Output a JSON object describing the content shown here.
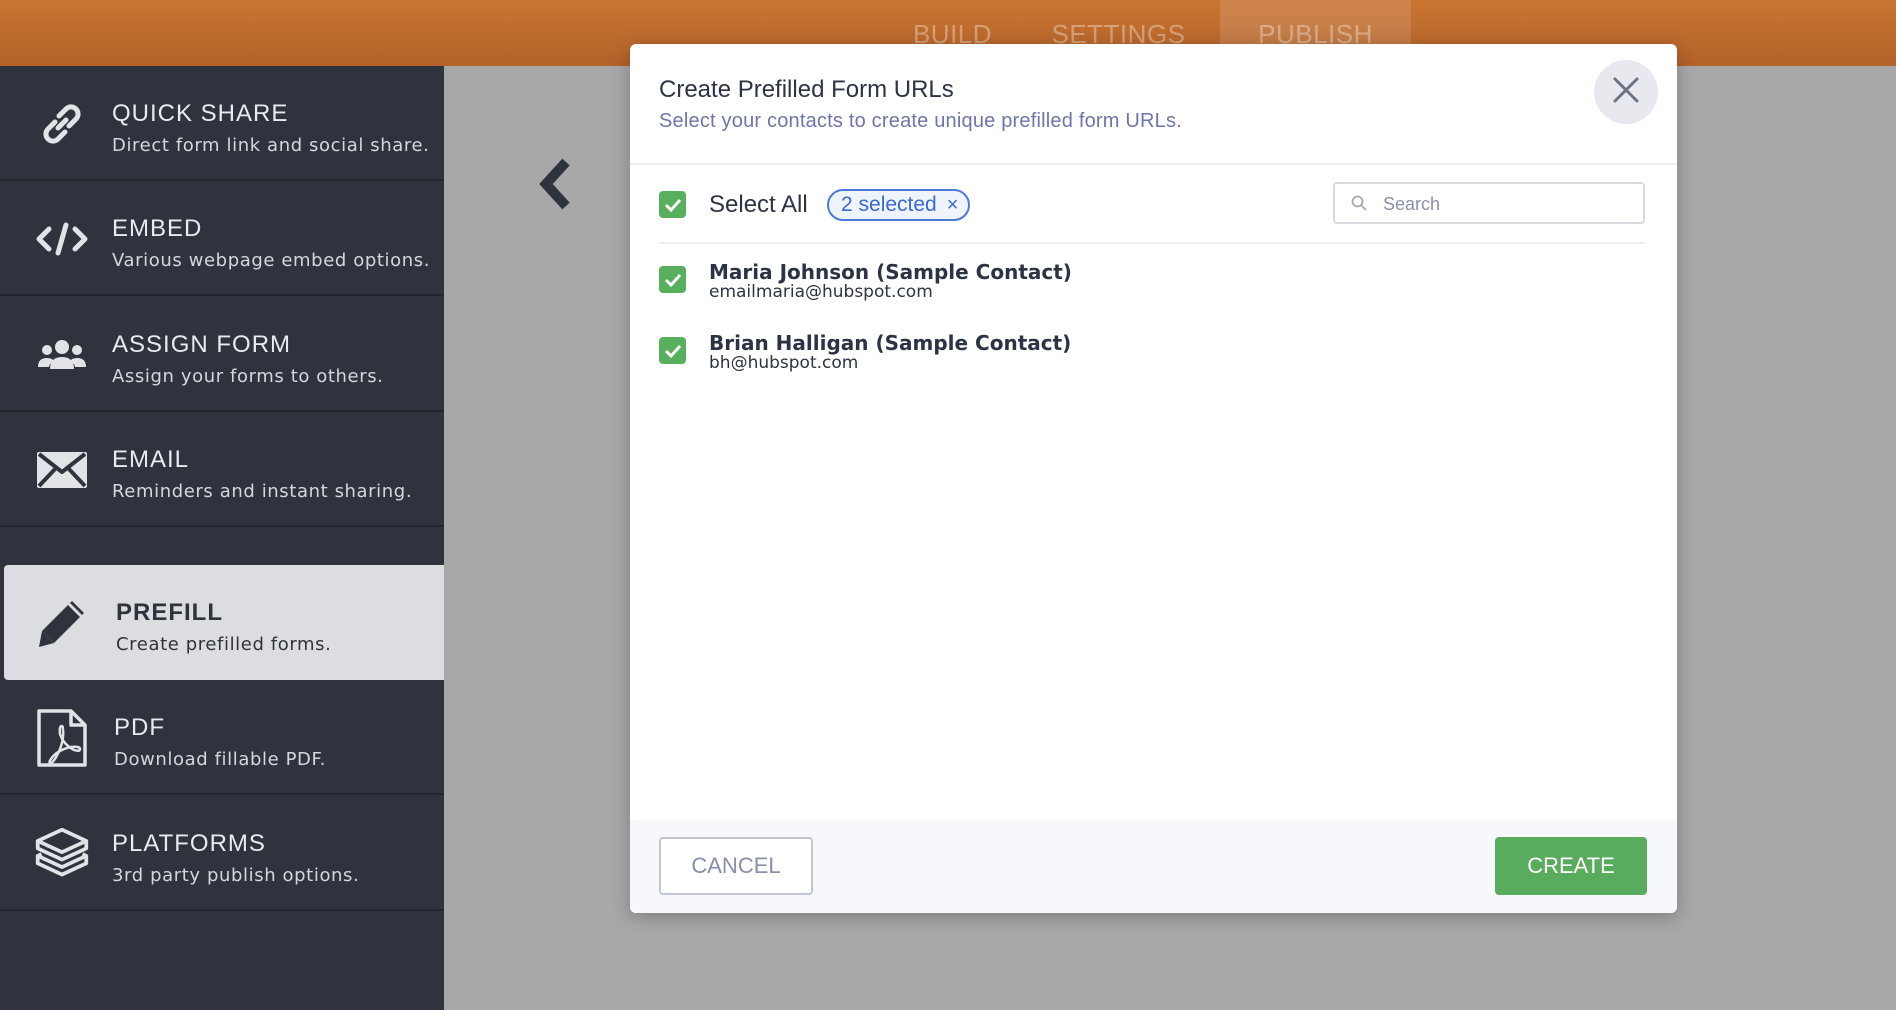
{
  "top_nav": {
    "tabs": [
      {
        "label": "BUILD",
        "active": false
      },
      {
        "label": "SETTINGS",
        "active": false
      },
      {
        "label": "PUBLISH",
        "active": true
      }
    ]
  },
  "sidebar": {
    "items": [
      {
        "title": "QUICK SHARE",
        "desc": "Direct form link and social share.",
        "icon": "link-icon"
      },
      {
        "title": "EMBED",
        "desc": "Various webpage embed options.",
        "icon": "code-icon"
      },
      {
        "title": "ASSIGN FORM",
        "desc": "Assign your forms to others.",
        "icon": "users-icon"
      },
      {
        "title": "EMAIL",
        "desc": "Reminders and instant sharing.",
        "icon": "envelope-icon"
      },
      {
        "title": "PREFILL",
        "desc": "Create prefilled forms.",
        "icon": "pencil-icon",
        "active": true
      },
      {
        "title": "PDF",
        "desc": "Download fillable PDF.",
        "icon": "pdf-icon"
      },
      {
        "title": "PLATFORMS",
        "desc": "3rd party publish options.",
        "icon": "layers-icon"
      }
    ]
  },
  "modal": {
    "title": "Create Prefilled Form URLs",
    "subtitle": "Select your contacts to create unique prefilled form URLs.",
    "select_all_label": "Select All",
    "selected_badge": "2 selected",
    "search_placeholder": "Search",
    "search_value": "",
    "contacts": [
      {
        "name": "Maria Johnson (Sample Contact)",
        "email": "emailmaria@hubspot.com",
        "checked": true
      },
      {
        "name": "Brian Halligan (Sample Contact)",
        "email": "bh@hubspot.com",
        "checked": true
      }
    ],
    "cancel_label": "CANCEL",
    "create_label": "CREATE"
  },
  "colors": {
    "topbar": "#c06b2e",
    "sidebar": "#2f333d",
    "accent_green": "#59ab5e",
    "badge_blue": "#4d7ad6"
  }
}
